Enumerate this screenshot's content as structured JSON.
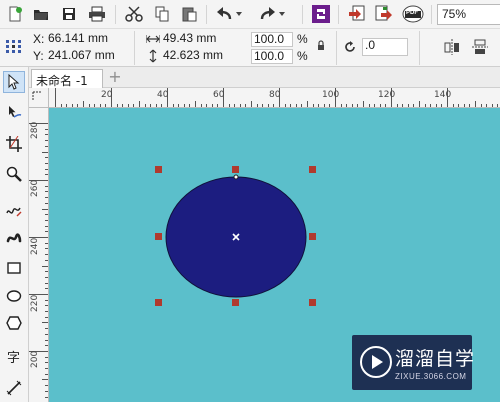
{
  "toolbar": {
    "buttons": [
      "new-document",
      "open",
      "save",
      "print",
      "cut",
      "copy",
      "paste",
      "undo",
      "redo",
      "corel-connect",
      "import",
      "export",
      "publish-pdf"
    ],
    "pdf_label": "PDF",
    "zoom_value": "75%"
  },
  "propbar": {
    "x_label": "X:",
    "x_value": "66.141 mm",
    "y_label": "Y:",
    "y_value": "241.067 mm",
    "width_value": "49.43 mm",
    "height_value": "42.623 mm",
    "scale_x": "100.0",
    "scale_y": "100.0",
    "percent_sign": "%",
    "rotation_value": ".0"
  },
  "tabs": [
    {
      "label": "未命名 -1",
      "active": true
    }
  ],
  "rulers": {
    "horizontal_labels": [
      "20",
      "40",
      "60",
      "80",
      "100",
      "120",
      "140"
    ],
    "vertical_labels": [
      "280",
      "260",
      "240",
      "220",
      "200"
    ]
  },
  "shape": {
    "type": "ellipse",
    "fill": "#1c1d80",
    "outline": "#10113a",
    "selected": true
  },
  "colors": {
    "canvas": "#5bbfcb",
    "handle": "#b03a2e"
  },
  "watermark": {
    "title": "溜溜自学",
    "url": "ZIXUE.3066.COM"
  }
}
